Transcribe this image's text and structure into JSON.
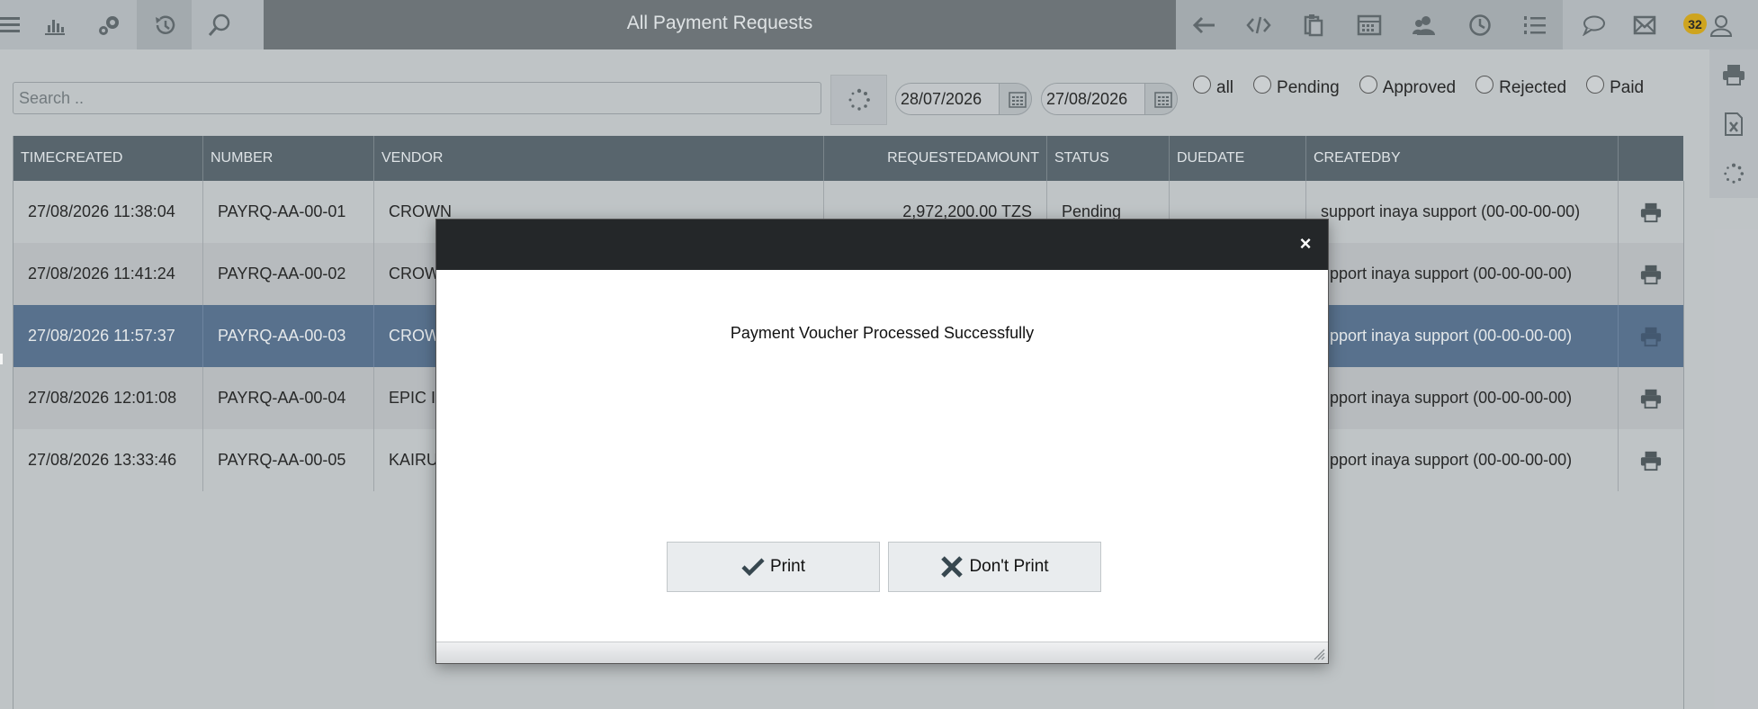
{
  "header": {
    "title": "All Payment Requests",
    "badge_count": "32",
    "left_icons": [
      "menu-icon",
      "bar-chart-icon",
      "settings-gears-icon",
      "history-icon",
      "search-icon"
    ],
    "right_icons": [
      "back-arrow-icon",
      "code-icon",
      "clipboard-icon",
      "keyboard-icon",
      "users-icon",
      "clock-icon",
      "list-icon"
    ],
    "far_icons": [
      "chat-icon",
      "mail-icon",
      "user-icon"
    ]
  },
  "filters": {
    "search_placeholder": "Search ..",
    "date_from": "28/07/2026",
    "date_to": "27/08/2026",
    "radios": [
      {
        "label": "all"
      },
      {
        "label": "Pending"
      },
      {
        "label": "Approved"
      },
      {
        "label": "Rejected"
      },
      {
        "label": "Paid"
      }
    ]
  },
  "side_tools": [
    "print-icon",
    "excel-icon",
    "refresh-icon"
  ],
  "table": {
    "columns": [
      "TIMECREATED",
      "NUMBER",
      "VENDOR",
      "REQUESTEDAMOUNT",
      "STATUS",
      "DUEDATE",
      "CREATEDBY"
    ],
    "rows": [
      {
        "time": "27/08/2026 11:38:04",
        "number": "PAYRQ-AA-00-01",
        "vendor": "CROWN",
        "amount": "2,972,200.00 TZS",
        "status": "Pending",
        "due": "",
        "created_by": "support inaya support (00-00-00-00)"
      },
      {
        "time": "27/08/2026 11:41:24",
        "number": "PAYRQ-AA-00-02",
        "vendor": "CROW",
        "amount": "",
        "status": "",
        "due": "",
        "created_by": "upport inaya support (00-00-00-00)"
      },
      {
        "time": "27/08/2026 11:57:37",
        "number": "PAYRQ-AA-00-03",
        "vendor": "CROW",
        "amount": "",
        "status": "",
        "due": "",
        "created_by": "upport inaya support (00-00-00-00)"
      },
      {
        "time": "27/08/2026 12:01:08",
        "number": "PAYRQ-AA-00-04",
        "vendor": "EPIC I",
        "amount": "",
        "status": "",
        "due": "",
        "created_by": "upport inaya support (00-00-00-00)"
      },
      {
        "time": "27/08/2026 13:33:46",
        "number": "PAYRQ-AA-00-05",
        "vendor": "KAIRU",
        "amount": "",
        "status": "",
        "due": "",
        "created_by": "upport inaya support (00-00-00-00)"
      }
    ]
  },
  "dialog": {
    "close_label": "×",
    "message": "Payment Voucher Processed Successfully",
    "print_label": "Print",
    "dont_print_label": "Don't Print"
  },
  "colors": {
    "header_title_bg": "#6d7478",
    "table_header_bg": "#56636c",
    "selected_row_bg": "#56708f",
    "badge_bg": "#d6a817",
    "dialog_header_bg": "#242729"
  }
}
